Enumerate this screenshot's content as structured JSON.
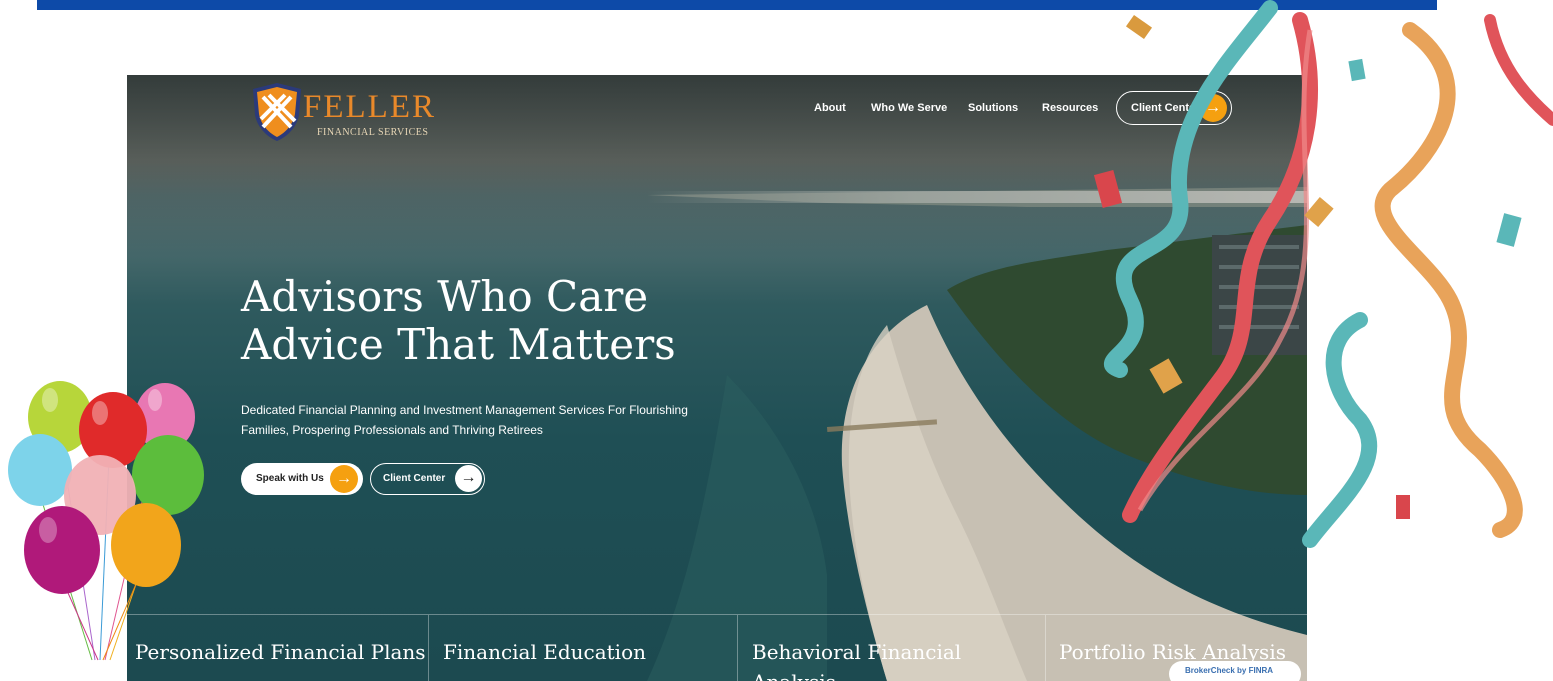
{
  "brand": {
    "name": "FELLER",
    "subtitle": "FINANCIAL SERVICES"
  },
  "nav": {
    "items": [
      "About",
      "Who We Serve",
      "Solutions",
      "Resources"
    ],
    "client_center": "Client Center"
  },
  "hero": {
    "headline_line1": "Advisors Who Care",
    "headline_line2": "Advice That Matters",
    "subtitle_line1": "Dedicated Financial Planning and Investment Management Services For Flourishing",
    "subtitle_line2": "Families, Prospering Professionals and Thriving Retirees",
    "cta_primary": "Speak with Us",
    "cta_secondary": "Client Center"
  },
  "services": [
    "Personalized Financial Plans",
    "Financial Education",
    "Behavioral Financial Analysis",
    "Portfolio Risk Analysis"
  ],
  "brokercheck": "BrokerCheck by FINRA",
  "colors": {
    "top_bar": "#0d4aa8",
    "accent_orange": "#f5a010",
    "logo_orange": "#e9892a"
  },
  "icons": {
    "logo": "shield-logo-icon",
    "arrow": "arrow-right-icon",
    "confetti": "confetti-streamers",
    "balloons": "balloons-cluster"
  }
}
